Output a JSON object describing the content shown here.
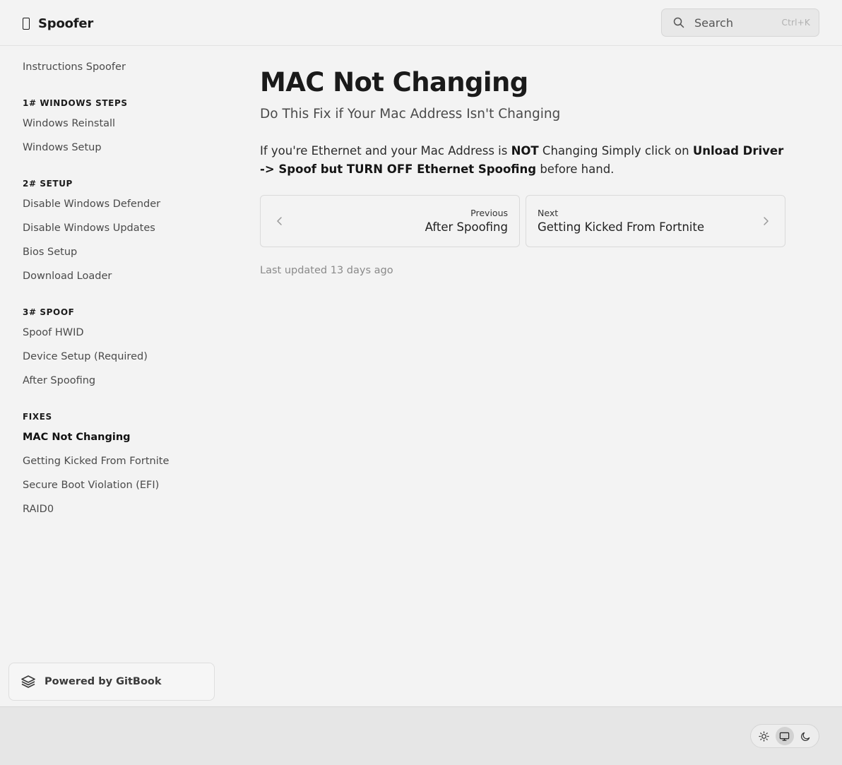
{
  "header": {
    "site_name": "Spoofer",
    "search_label": "Search",
    "search_shortcut": "Ctrl+K",
    "search_icon": "magnifier-icon"
  },
  "sidebar": {
    "top_item": "Instructions Spoofer",
    "groups": [
      {
        "title": "1# WINDOWS STEPS",
        "items": [
          "Windows Reinstall",
          "Windows Setup"
        ]
      },
      {
        "title": "2# SETUP",
        "items": [
          "Disable Windows Defender",
          "Disable Windows Updates",
          "Bios Setup",
          "Download Loader"
        ]
      },
      {
        "title": "3# SPOOF",
        "items": [
          "Spoof HWID",
          "Device Setup (Required)",
          "After Spoofing"
        ]
      },
      {
        "title": "FIXES",
        "items": [
          "MAC Not Changing",
          "Getting Kicked From Fortnite",
          "Secure Boot Violation (EFI)",
          "RAID0"
        ]
      }
    ],
    "active_item": "MAC Not Changing",
    "powered_by": "Powered by GitBook"
  },
  "main": {
    "title": "MAC Not Changing",
    "subtitle": "Do This Fix if Your Mac Address Isn't Changing",
    "body": {
      "part1": "If you're Ethernet and your Mac Address is ",
      "bold1": "NOT",
      "part2": " Changing Simply click on ",
      "bold2": "Unload Driver -> Spoof but TURN OFF Ethernet Spoofing",
      "part3": " before hand."
    },
    "prev": {
      "label": "Previous",
      "title": "After Spoofing"
    },
    "next": {
      "label": "Next",
      "title": "Getting Kicked From Fortnite"
    },
    "last_updated": "Last updated 13 days ago"
  },
  "footer": {
    "theme_modes": [
      "light",
      "system",
      "dark"
    ],
    "selected_theme": "system"
  }
}
